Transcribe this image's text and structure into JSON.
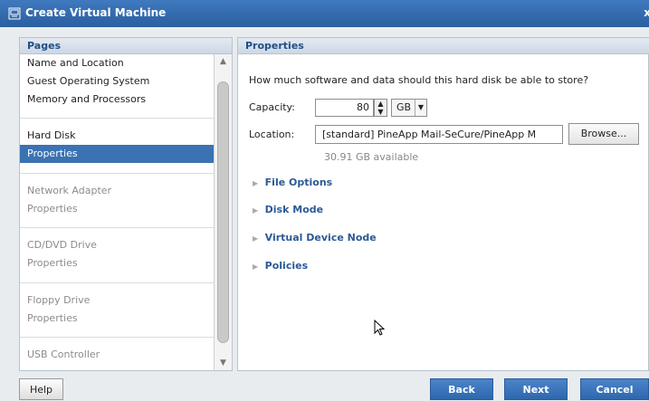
{
  "window": {
    "title": "Create Virtual Machine",
    "close_label": "x"
  },
  "pages": {
    "header": "Pages",
    "items": [
      {
        "label": "Name and Location"
      },
      {
        "label": "Guest Operating System"
      },
      {
        "label": "Memory and Processors"
      },
      {
        "label": "Hard Disk"
      },
      {
        "label": "Properties"
      },
      {
        "label": "Network Adapter"
      },
      {
        "label": "Properties"
      },
      {
        "label": "CD/DVD Drive"
      },
      {
        "label": "Properties"
      },
      {
        "label": "Floppy Drive"
      },
      {
        "label": "Properties"
      },
      {
        "label": "USB Controller"
      }
    ]
  },
  "properties": {
    "header": "Properties",
    "question": "How much software and data should this hard disk be able to store?",
    "capacity_label": "Capacity:",
    "capacity_value": "80",
    "capacity_unit": "GB",
    "location_label": "Location:",
    "location_value": "[standard] PineApp Mail-SeCure/PineApp M",
    "browse_label": "Browse...",
    "available": "30.91 GB available",
    "sections": [
      "File Options",
      "Disk Mode",
      "Virtual Device Node",
      "Policies"
    ]
  },
  "footer": {
    "help": "Help",
    "back": "Back",
    "next": "Next",
    "cancel": "Cancel"
  },
  "colors": {
    "title_bar": "#2f66aa",
    "selected": "#3b72b3",
    "section_text": "#2b5a95"
  }
}
